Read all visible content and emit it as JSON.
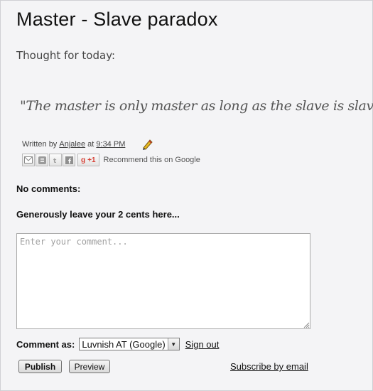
{
  "post": {
    "title": "Master - Slave paradox",
    "intro": "Thought for today:",
    "quote": "\"The master is only master as long as the slave is slave.\""
  },
  "footer": {
    "written_by": "Written by",
    "author": "Anjalee",
    "at": "at",
    "time": "9:34 PM"
  },
  "share": {
    "buttons": [
      "email-icon",
      "blogger-icon",
      "twitter-icon",
      "facebook-icon"
    ],
    "gplus_label": "+1",
    "recommend": "Recommend this on Google"
  },
  "comments": {
    "count_text": "No comments:",
    "prompt": "Generously leave your 2 cents here...",
    "placeholder": "Enter your comment...",
    "comment_as_label": "Comment as:",
    "identity": "Luvnish AT (Google)",
    "sign_out": "Sign out",
    "publish": "Publish",
    "preview": "Preview",
    "subscribe": "Subscribe by email"
  },
  "colors": {
    "background": "#f4f4f6",
    "gplus_red": "#d73d32",
    "pencil_yellow": "#e8b923"
  }
}
